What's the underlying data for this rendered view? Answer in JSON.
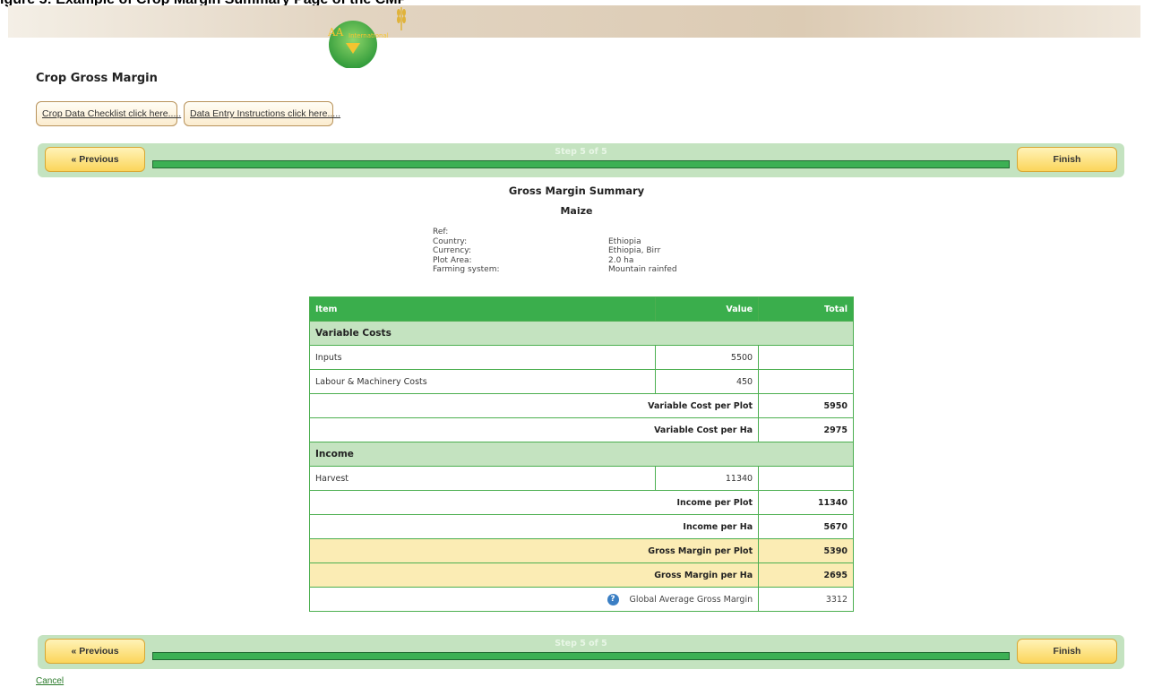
{
  "document": {
    "caption": "igure 5: Example of Crop Margin Summary Page of the CMP"
  },
  "header": {
    "logo_text": "AA",
    "logo_subtext": "International"
  },
  "page": {
    "title": "Crop Gross Margin"
  },
  "links": {
    "checklist": "Crop Data Checklist click here.....",
    "instructions": "Data Entry Instructions click here....."
  },
  "stepbar": {
    "previous_label": "« Previous",
    "finish_label": "Finish",
    "step_label": "Step 5 of 5",
    "progress": 1.0
  },
  "summary": {
    "title": "Gross Margin Summary",
    "crop": "Maize",
    "meta": [
      {
        "key": "Ref:",
        "value": ""
      },
      {
        "key": "Country:",
        "value": "Ethiopia"
      },
      {
        "key": "Currency:",
        "value": "Ethiopia, Birr"
      },
      {
        "key": "Plot Area:",
        "value": "2.0 ha"
      },
      {
        "key": "Farming system:",
        "value": "Mountain rainfed"
      }
    ]
  },
  "table": {
    "headers": {
      "item": "Item",
      "value": "Value",
      "total": "Total"
    },
    "variable_costs_label": "Variable Costs",
    "inputs": {
      "label": "Inputs",
      "value": "5500"
    },
    "labour": {
      "label": "Labour & Machinery Costs",
      "value": "450"
    },
    "var_cost_plot": {
      "label": "Variable Cost per Plot",
      "total": "5950"
    },
    "var_cost_ha": {
      "label": "Variable Cost per Ha",
      "total": "2975"
    },
    "income_label": "Income",
    "harvest": {
      "label": "Harvest",
      "value": "11340"
    },
    "income_plot": {
      "label": "Income per Plot",
      "total": "11340"
    },
    "income_ha": {
      "label": "Income per Ha",
      "total": "5670"
    },
    "gm_plot": {
      "label": "Gross Margin per Plot",
      "total": "5390"
    },
    "gm_ha": {
      "label": "Gross Margin per Ha",
      "total": "2695"
    },
    "global_avg": {
      "label": "Global Average Gross Margin",
      "total": "3312"
    }
  },
  "footer": {
    "cancel_label": "Cancel"
  },
  "colors": {
    "accent_green": "#3aae4c",
    "light_green": "#c4e3c0",
    "highlight_yellow": "#fbecb4",
    "button_gold": "#fbd55a"
  }
}
